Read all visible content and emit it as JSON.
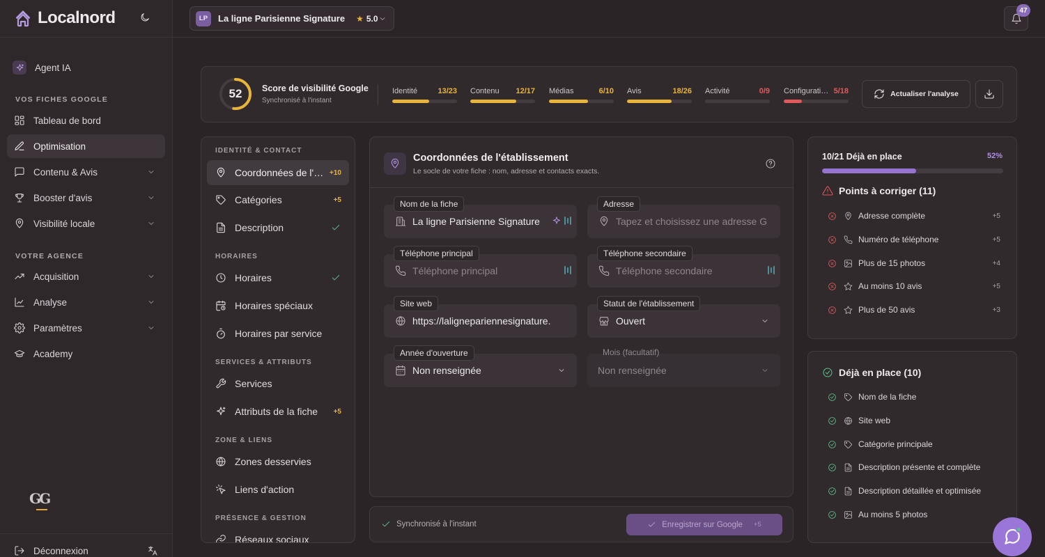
{
  "app": {
    "brand": "Localnord"
  },
  "sidebar": {
    "agent": "Agent IA",
    "section_fiches": "VOS FICHES GOOGLE",
    "items_fiches": [
      {
        "label": "Tableau de bord",
        "icon": "dashboard-icon"
      },
      {
        "label": "Optimisation",
        "icon": "edit-icon",
        "active": true
      },
      {
        "label": "Contenu & Avis",
        "icon": "message-icon"
      },
      {
        "label": "Booster d'avis",
        "icon": "trophy-icon"
      },
      {
        "label": "Visibilité locale",
        "icon": "pin-icon"
      }
    ],
    "section_agence": "VOTRE AGENCE",
    "items_agence": [
      {
        "label": "Acquisition",
        "icon": "trend-icon"
      },
      {
        "label": "Analyse",
        "icon": "chart-icon"
      },
      {
        "label": "Paramètres",
        "icon": "gear-icon"
      },
      {
        "label": "Academy",
        "icon": "graduation-icon"
      }
    ],
    "footer_logo": "GG",
    "logout": "Déconnexion"
  },
  "topbar": {
    "initials": "LP",
    "business": "La ligne Parisienne Signature",
    "rating": "5.0",
    "notifications": "47"
  },
  "score": {
    "value": "52",
    "value_fraction": 0.52,
    "title": "Score de visibilité Google",
    "subtitle": "Synchronisé à l'instant",
    "metrics": [
      {
        "label": "Identité",
        "value": "13/23",
        "fraction": 0.565,
        "color": "#e9b43a"
      },
      {
        "label": "Contenu",
        "value": "12/17",
        "fraction": 0.706,
        "color": "#e9b43a"
      },
      {
        "label": "Médias",
        "value": "6/10",
        "fraction": 0.6,
        "color": "#e9b43a"
      },
      {
        "label": "Avis",
        "value": "18/26",
        "fraction": 0.692,
        "color": "#e9b43a"
      },
      {
        "label": "Activité",
        "value": "0/9",
        "fraction": 0,
        "color": "#e05a5a"
      },
      {
        "label": "Configurati…",
        "value": "5/18",
        "fraction": 0.278,
        "color": "#e05a5a"
      }
    ],
    "refresh_label": "Actualiser l'analyse"
  },
  "sections": {
    "groups": [
      {
        "title": "IDENTITÉ & CONTACT",
        "items": [
          {
            "label": "Coordonnées de l'établissement",
            "icon": "pin-icon",
            "points": "+10",
            "active": true
          },
          {
            "label": "Catégories",
            "icon": "tag-icon",
            "points": "+5"
          },
          {
            "label": "Description",
            "icon": "document-icon",
            "done": true
          }
        ]
      },
      {
        "title": "HORAIRES",
        "items": [
          {
            "label": "Horaires",
            "icon": "clock-icon",
            "done": true
          },
          {
            "label": "Horaires spéciaux",
            "icon": "calendar-clock-icon"
          },
          {
            "label": "Horaires par service",
            "icon": "timer-icon"
          }
        ]
      },
      {
        "title": "SERVICES & ATTRIBUTS",
        "items": [
          {
            "label": "Services",
            "icon": "wrench-icon"
          },
          {
            "label": "Attributs de la fiche",
            "icon": "sparkle-icon",
            "points": "+5"
          }
        ]
      },
      {
        "title": "ZONE & LIENS",
        "items": [
          {
            "label": "Zones desservies",
            "icon": "globe-icon"
          },
          {
            "label": "Liens d'action",
            "icon": "click-icon"
          }
        ]
      },
      {
        "title": "PRÉSENCE & GESTION",
        "items": [
          {
            "label": "Réseaux sociaux",
            "icon": "link-icon"
          }
        ]
      }
    ]
  },
  "form": {
    "title": "Coordonnées de l'établissement",
    "subtitle": "Le socle de votre fiche : nom, adresse et contacts exacts.",
    "fields": {
      "name_label": "Nom de la fiche",
      "name_value": "La ligne Parisienne Signature",
      "address_label": "Adresse",
      "address_placeholder": "Tapez et choisissez une adresse G",
      "phone1_label": "Téléphone principal",
      "phone1_placeholder": "Téléphone principal",
      "phone2_label": "Téléphone secondaire",
      "phone2_placeholder": "Téléphone secondaire",
      "website_label": "Site web",
      "website_value": "https://lalignepariennesignature.",
      "status_label": "Statut de l'établissement",
      "status_value": "Ouvert",
      "year_label": "Année d'ouverture",
      "year_value": "Non renseignée",
      "month_label": "Mois (facultatif)",
      "month_value": "Non renseignée"
    }
  },
  "save_bar": {
    "sync": "Synchronisé à l'instant",
    "save_label": "Enregistrer sur Google",
    "save_points": "+5"
  },
  "checklist": {
    "progress_label": "10/21 Déjà en place",
    "progress_pct": "52%",
    "progress_fraction": 0.52,
    "todo_title": "Points à corriger (11)",
    "todo": [
      {
        "label": "Adresse complète",
        "icon": "pin-icon",
        "points": "+5"
      },
      {
        "label": "Numéro de téléphone",
        "icon": "phone-icon",
        "points": "+5"
      },
      {
        "label": "Plus de 15 photos",
        "icon": "image-icon",
        "points": "+4"
      },
      {
        "label": "Au moins 10 avis",
        "icon": "star-icon",
        "points": "+5"
      },
      {
        "label": "Plus de 50 avis",
        "icon": "star-icon",
        "points": "+3"
      }
    ],
    "done_title": "Déjà en place (10)",
    "done": [
      {
        "label": "Nom de la fiche",
        "icon": "tag-icon"
      },
      {
        "label": "Site web",
        "icon": "globe-icon"
      },
      {
        "label": "Catégorie principale",
        "icon": "tag-icon"
      },
      {
        "label": "Description présente et complète",
        "icon": "document-icon"
      },
      {
        "label": "Description détaillée et optimisée",
        "icon": "document-icon"
      },
      {
        "label": "Au moins 5 photos",
        "icon": "image-icon"
      }
    ]
  }
}
